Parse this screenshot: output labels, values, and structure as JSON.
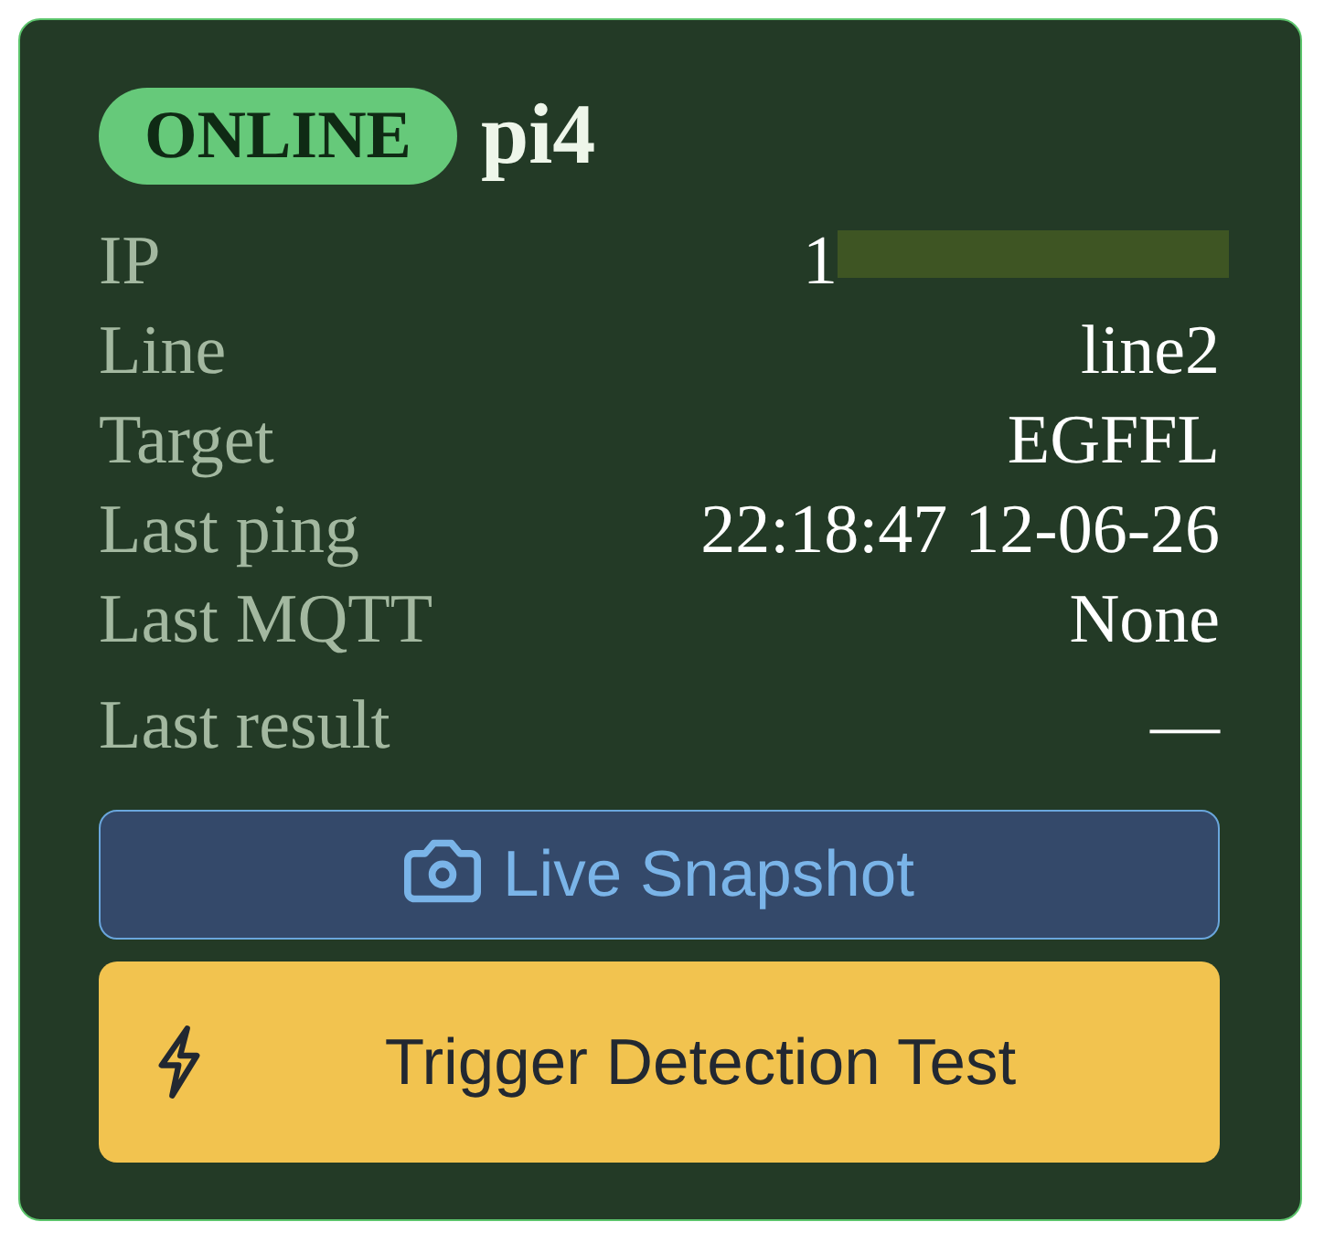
{
  "device": {
    "status": "ONLINE",
    "online": true,
    "name": "pi4"
  },
  "rows": [
    {
      "label": "IP",
      "value": "1",
      "redacted": true
    },
    {
      "label": "Line",
      "value": "line2",
      "redacted": false
    },
    {
      "label": "Target",
      "value": "EGFFL",
      "redacted": false
    },
    {
      "label": "Last ping",
      "value": "22:18:47 12-06-26",
      "redacted": false
    },
    {
      "label": "Last MQTT",
      "value": "None",
      "redacted": false
    },
    {
      "label": "Last result",
      "value": "—",
      "redacted": false
    }
  ],
  "buttons": [
    {
      "kind": "snapshot",
      "label": "Live Snapshot"
    },
    {
      "kind": "trigger",
      "label": "Trigger Detection Test"
    }
  ]
}
